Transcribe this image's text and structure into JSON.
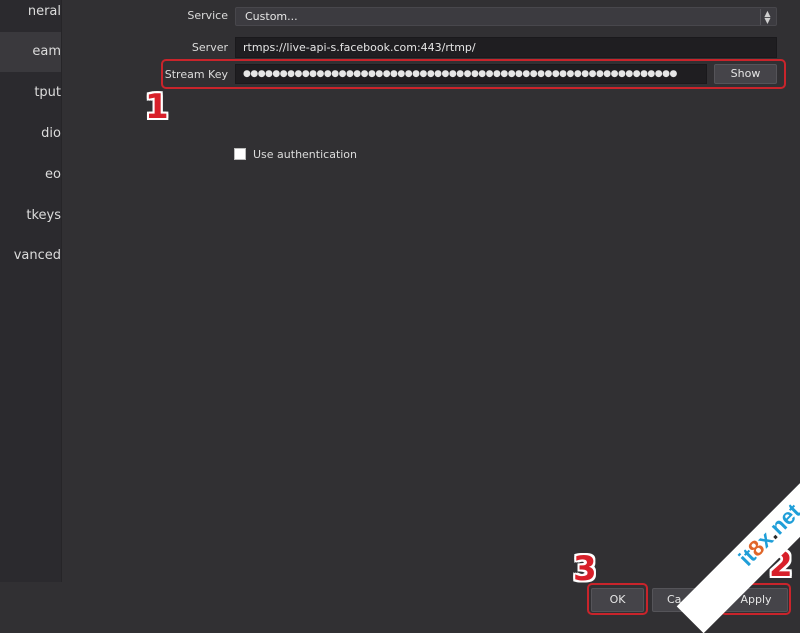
{
  "sidebar": {
    "items": [
      {
        "label": "neral"
      },
      {
        "label": "eam"
      },
      {
        "label": "tput"
      },
      {
        "label": "dio"
      },
      {
        "label": "eo"
      },
      {
        "label": "tkeys"
      },
      {
        "label": "vanced"
      }
    ]
  },
  "form": {
    "service_label": "Service",
    "service_value": "Custom...",
    "server_label": "Server",
    "server_value": "rtmps://live-api-s.facebook.com:443/rtmp/",
    "stream_key_label": "Stream Key",
    "stream_key_value": "●●●●●●●●●●●●●●●●●●●●●●●●●●●●●●●●●●●●●●●●●●●●●●●●●●●●●●●●●●●",
    "show_button": "Show",
    "use_auth_label": "Use authentication"
  },
  "footer": {
    "ok_label": "OK",
    "cancel_label": "Ca",
    "apply_label": "Apply"
  },
  "annotations": {
    "step1": "1",
    "step2": "2",
    "step3": "3",
    "color": "#d8202a"
  },
  "watermark": {
    "it": "it",
    "eight": "8",
    "x": "x",
    "dot": ".",
    "net": "net"
  }
}
